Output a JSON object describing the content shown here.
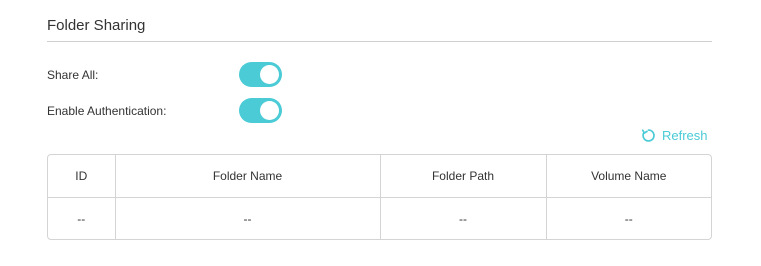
{
  "section": {
    "title": "Folder Sharing"
  },
  "settings": {
    "share_all": {
      "label": "Share All:",
      "enabled": true
    },
    "enable_authentication": {
      "label": "Enable Authentication:",
      "enabled": true
    }
  },
  "refresh": {
    "label": "Refresh",
    "icon": "refresh-icon"
  },
  "table": {
    "columns": [
      "ID",
      "Folder Name",
      "Folder Path",
      "Volume Name"
    ],
    "rows": [
      [
        "--",
        "--",
        "--",
        "--"
      ]
    ]
  },
  "colors": {
    "accent": "#4acbd6",
    "border": "#d4d4d4",
    "text": "#333333"
  }
}
